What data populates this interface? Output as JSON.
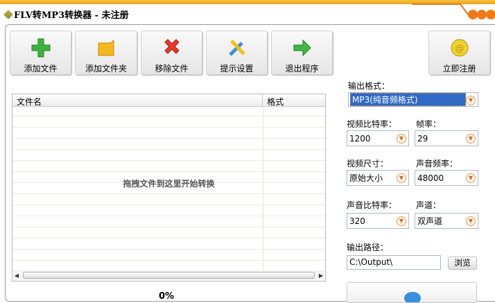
{
  "window": {
    "title": "FLV转MP3转换器 - 未注册"
  },
  "toolbar": [
    {
      "label": "添加文件",
      "icon": "add-plus-icon"
    },
    {
      "label": "添加文件夹",
      "icon": "folder-icon"
    },
    {
      "label": "移除文件",
      "icon": "remove-x-icon"
    },
    {
      "label": "提示设置",
      "icon": "tools-icon"
    },
    {
      "label": "退出程序",
      "icon": "arrow-right-icon"
    }
  ],
  "register": {
    "label": "立即注册",
    "icon": "coin-icon"
  },
  "file_list": {
    "columns": [
      "文件名",
      "格式"
    ],
    "drop_hint": "拖拽文件到这里开始转换"
  },
  "settings": {
    "output_format_label": "输出格式：",
    "output_format": "MP3(纯音频格式)",
    "video_bitrate_label": "视频比特率：",
    "video_bitrate": "1200",
    "frame_rate_label": "帧率：",
    "frame_rate": "29",
    "video_size_label": "视频尺寸：",
    "video_size": "原始大小",
    "audio_freq_label": "声音频率：",
    "audio_freq": "48000",
    "audio_bitrate_label": "声音比特率：",
    "audio_bitrate": "320",
    "channel_label": "声道：",
    "channel": "双声道",
    "output_path_label": "输出路径：",
    "output_path": "C:\\Output\\",
    "browse_label": "浏览"
  },
  "progress": {
    "text": "0%"
  }
}
